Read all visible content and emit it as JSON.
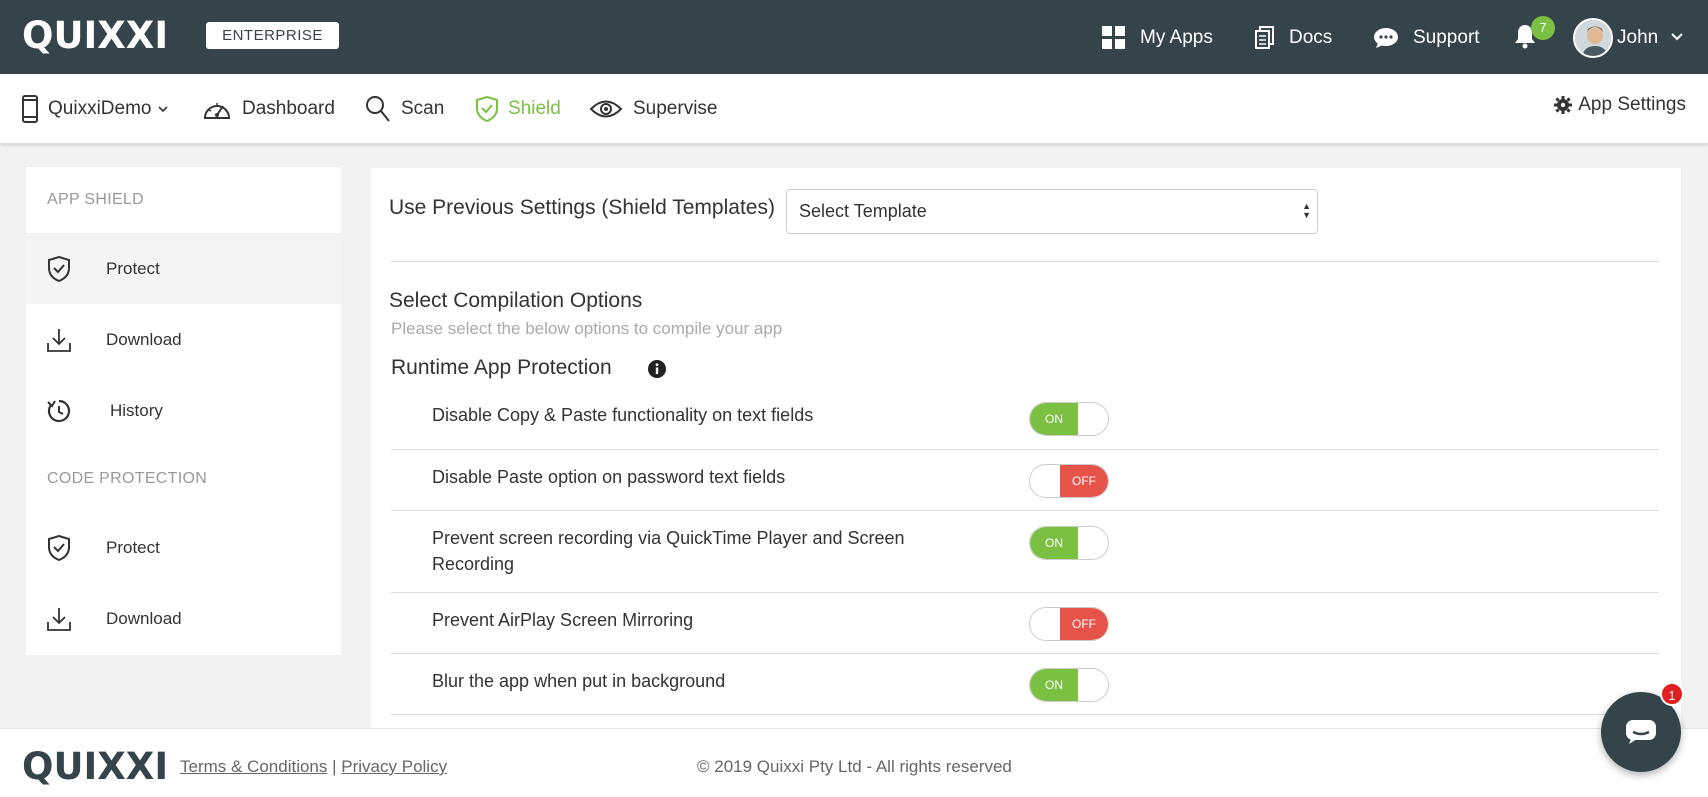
{
  "topbar": {
    "logo": "QUIXXI",
    "edition_badge": "ENTERPRISE",
    "nav": [
      {
        "label": "My Apps",
        "icon": "grid-icon"
      },
      {
        "label": "Docs",
        "icon": "docs-icon"
      },
      {
        "label": "Support",
        "icon": "chat-bubble-icon"
      }
    ],
    "notifications_count": "7",
    "user_name": "John"
  },
  "subnav": {
    "app_selector": "QuixxiDemo",
    "items": [
      {
        "label": "Dashboard",
        "icon": "speedometer-icon"
      },
      {
        "label": "Scan",
        "icon": "search-icon"
      },
      {
        "label": "Shield",
        "icon": "shield-icon",
        "active": true
      },
      {
        "label": "Supervise",
        "icon": "eye-icon"
      }
    ],
    "app_settings": "App Settings",
    "accent_color": "#7bc043"
  },
  "sidebar": {
    "sections": [
      {
        "heading": "APP SHIELD",
        "items": [
          {
            "label": "Protect",
            "icon": "shield-check-icon",
            "active": true
          },
          {
            "label": "Download",
            "icon": "download-icon"
          },
          {
            "label": "History",
            "icon": "history-icon"
          }
        ]
      },
      {
        "heading": "CODE PROTECTION",
        "items": [
          {
            "label": "Protect",
            "icon": "shield-check-icon"
          },
          {
            "label": "Download",
            "icon": "download-icon"
          }
        ]
      }
    ]
  },
  "main": {
    "template_label": "Use Previous Settings (Shield Templates)",
    "template_select_value": "Select Template",
    "compilation_title": "Select Compilation Options",
    "compilation_subtitle": "Please select the below options to compile your app",
    "runtime_title": "Runtime App Protection",
    "options": [
      {
        "label": "Disable Copy & Paste functionality on text fields",
        "state": "ON"
      },
      {
        "label": "Disable Paste option on password text fields",
        "state": "OFF"
      },
      {
        "label": "Prevent screen recording via QuickTime Player and Screen Recording",
        "state": "ON"
      },
      {
        "label": "Prevent AirPlay Screen Mirroring",
        "state": "OFF"
      },
      {
        "label": "Blur the app when put in background",
        "state": "ON"
      }
    ],
    "on_color": "#7bc043",
    "off_color": "#e55349"
  },
  "footer": {
    "logo": "QUIXXI",
    "terms": "Terms & Conditions",
    "separator": "|",
    "privacy": "Privacy Policy",
    "copyright": "© 2019 Quixxi Pty Ltd - All rights reserved"
  },
  "chat": {
    "unread": "1"
  }
}
